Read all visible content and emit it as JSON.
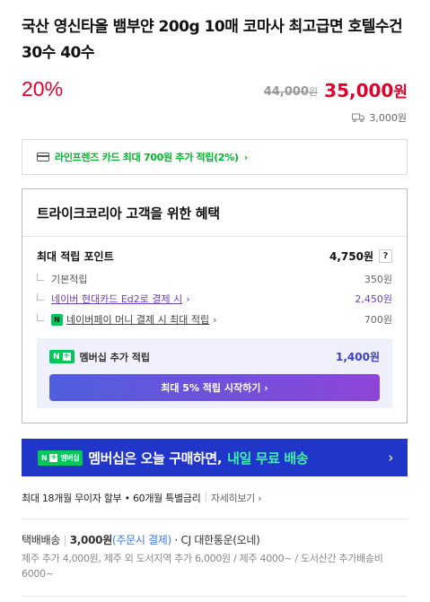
{
  "product": {
    "title": "국산 영신타올 뱀부얀 200g 10매 코마사 최고급면 호텔수건 30수 40수"
  },
  "price": {
    "discount": "20%",
    "original": "44,000",
    "original_unit": "원",
    "sale": "35,000",
    "sale_unit": "원"
  },
  "shipping_fee": "3,000원",
  "card_promo": "라인프렌즈 카드 최대 700원 추가 적립(2%)",
  "benefit": {
    "title": "트라이크코리아 고객을 위한 혜택",
    "max_points_label": "최대 적립 포인트",
    "max_points_value": "4,750원",
    "help": "?",
    "rows": [
      {
        "label": "기본적립",
        "value": "350원"
      },
      {
        "label": "네이버 현대카드 Ed2로 결제 시",
        "value": "2,450원"
      },
      {
        "label": "네이버페이 머니 결제 시 최대 적립",
        "value": "700원"
      }
    ],
    "npay_badge": "N",
    "membership_badge": "N",
    "membership_badge_plus": "+",
    "membership_label": "멤버십 추가 적립",
    "membership_value": "1,400원",
    "membership_button": "최대 5% 적립 시작하기"
  },
  "banner": {
    "badge_text": "멤버십",
    "text_before": "멤버십은 오늘 구매하면,",
    "text_highlight": "내일 무료 배송"
  },
  "installment": {
    "text": "최대 18개월 무이자 할부 • 60개월 특별금리",
    "more": "자세히보기"
  },
  "delivery": {
    "type": "택배배송",
    "fee": "3,000원",
    "fee_note": "(주문시 결제)",
    "carrier": "CJ 대한통운(오네)",
    "extra": "제주 추가 4,000원, 제주 외 도서지역 추가 6,000원 / 제주 4000~ / 도서산간 추가배송비 6000~"
  }
}
